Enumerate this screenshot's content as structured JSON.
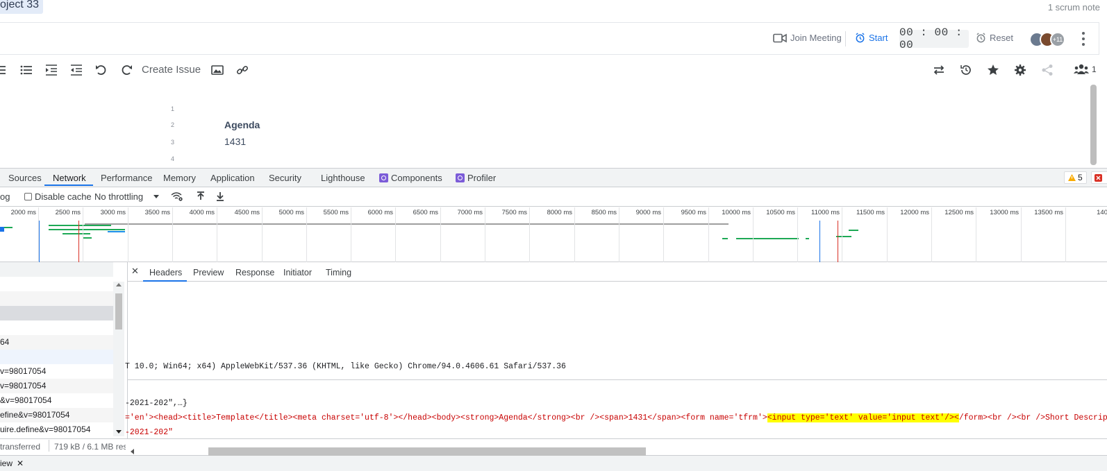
{
  "app": {
    "project_title": "oject 33",
    "scrum_note": "1 scrum note",
    "meeting": {
      "join_label": "Join Meeting",
      "start_label": "Start",
      "timer": "00 : 00 : 00",
      "reset_label": "Reset",
      "avatar_more": "+11"
    },
    "toolbar": {
      "create_issue": "Create Issue",
      "users_count": "1"
    },
    "editor": {
      "lines": [
        "1",
        "2",
        "3",
        "4"
      ],
      "heading": "Agenda",
      "body": "1431"
    }
  },
  "devtools": {
    "tabs": [
      "Sources",
      "Network",
      "Performance",
      "Memory",
      "Application",
      "Security",
      "Lighthouse",
      "Components",
      "Profiler"
    ],
    "active_tab": "Network",
    "warnings": "5",
    "controls": {
      "log_label": "og",
      "disable_cache": "Disable cache",
      "throttling": "No throttling"
    },
    "timeline_ticks": [
      "2000 ms",
      "2500 ms",
      "3000 ms",
      "3500 ms",
      "4000 ms",
      "4500 ms",
      "5000 ms",
      "5500 ms",
      "6000 ms",
      "6500 ms",
      "7000 ms",
      "7500 ms",
      "8000 ms",
      "8500 ms",
      "9000 ms",
      "9500 ms",
      "10000 ms",
      "10500 ms",
      "11000 ms",
      "11500 ms",
      "12000 ms",
      "12500 ms",
      "13000 ms",
      "13500 ms",
      "140"
    ],
    "requests": [
      "64",
      "v=98017054",
      "v=98017054",
      "&v=98017054",
      "efine&v=98017054",
      "uire.define&v=98017054"
    ],
    "status": {
      "transferred": "transferred",
      "resources": "719 kB / 6.1 MB res"
    },
    "drawer_label": "iew",
    "detail_tabs": [
      "Headers",
      "Preview",
      "Response",
      "Initiator",
      "Timing"
    ],
    "active_detail_tab": "Headers",
    "user_agent": "T 10.0; Win64; x64) AppleWebKit/537.36 (KHTML, like Gecko) Chrome/94.0.4606.61 Safari/537.36",
    "payload_line1": "-2021-202\",…}",
    "payload_line2_pre": "='en'><head><title>Template</title><meta charset='utf-8'></head><body><strong>Agenda</strong><br /><span>1431</span><form name='tfrm'>",
    "payload_line2_hl": "<input type='text' value='input text'/><",
    "payload_line2_post": "/form><br /><br />Short Description<br /",
    "payload_line3": "-2021-202\""
  }
}
